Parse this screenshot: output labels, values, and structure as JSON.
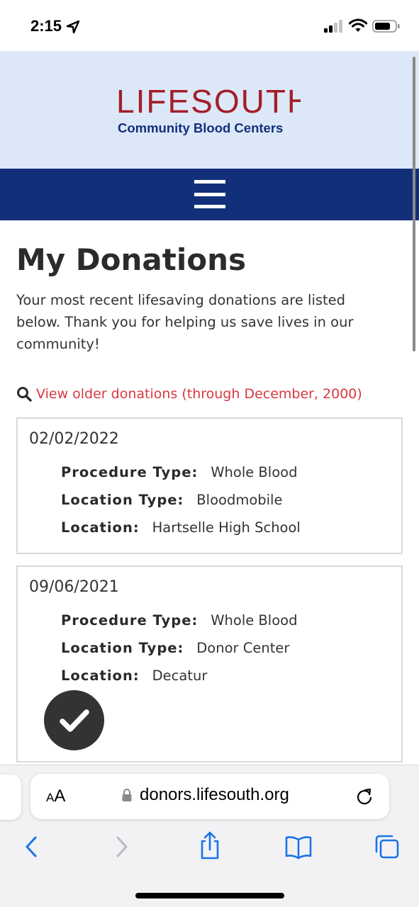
{
  "status_bar": {
    "time": "2:15",
    "icons": [
      "location-arrow-icon",
      "cellular-signal-icon",
      "wifi-icon",
      "battery-icon"
    ]
  },
  "header": {
    "logo_name": "LIFESOUTH",
    "logo_tagline": "Community Blood Centers",
    "logo_color": "#a31f2a",
    "tagline_color": "#12307a",
    "background": "#dce8f8",
    "nav_background": "#12307a",
    "menu_icon": "hamburger-menu-icon"
  },
  "main": {
    "title": "My Donations",
    "intro": "Your most recent lifesaving donations are listed below. Thank you for helping us save lives in our community!",
    "older_link": {
      "icon": "search-icon",
      "label": "View older donations (through December, 2000)",
      "color": "#d9383f"
    },
    "donations": [
      {
        "date": "02/02/2022",
        "procedure_type_label": "Procedure Type:",
        "procedure_type": "Whole Blood",
        "location_type_label": "Location Type:",
        "location_type": "Bloodmobile",
        "location_label": "Location:",
        "location": "Hartselle High School"
      },
      {
        "date": "09/06/2021",
        "procedure_type_label": "Procedure Type:",
        "procedure_type": "Whole Blood",
        "location_type_label": "Location Type:",
        "location_type": "Donor Center",
        "location_label": "Location:",
        "location": "Decatur"
      }
    ],
    "overlay_badge_icon": "checkmark-icon"
  },
  "browser": {
    "text_size_label_small": "A",
    "text_size_label_big": "A",
    "url": "donors.lifesouth.org",
    "toolbar_icons": [
      "back-icon",
      "forward-icon",
      "share-icon",
      "bookmarks-icon",
      "tabs-icon"
    ]
  }
}
